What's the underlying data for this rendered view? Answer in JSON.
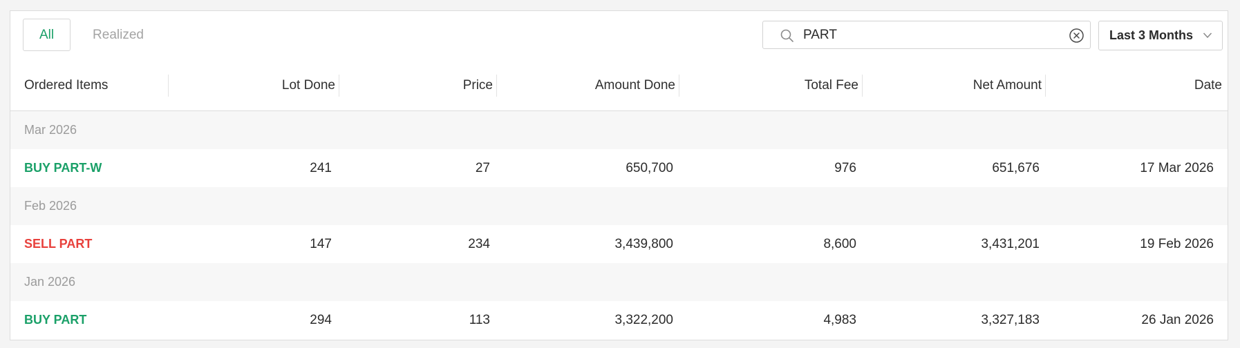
{
  "tabs": {
    "all": "All",
    "realized": "Realized"
  },
  "search": {
    "value": "PART",
    "placeholder": ""
  },
  "period": {
    "label": "Last 3 Months"
  },
  "columns": {
    "item": "Ordered Items",
    "lot": "Lot Done",
    "price": "Price",
    "amount": "Amount Done",
    "fee": "Total Fee",
    "net": "Net Amount",
    "date": "Date"
  },
  "groups": [
    {
      "label": "Mar 2026",
      "row": {
        "item": "BUY PART-W",
        "side": "buy",
        "lot": "241",
        "price": "27",
        "amount": "650,700",
        "fee": "976",
        "net": "651,676",
        "date": "17 Mar 2026"
      }
    },
    {
      "label": "Feb 2026",
      "row": {
        "item": "SELL PART",
        "side": "sell",
        "lot": "147",
        "price": "234",
        "amount": "3,439,800",
        "fee": "8,600",
        "net": "3,431,201",
        "date": "19 Feb 2026"
      }
    },
    {
      "label": "Jan 2026",
      "row": {
        "item": "BUY PART",
        "side": "buy",
        "lot": "294",
        "price": "113",
        "amount": "3,322,200",
        "fee": "4,983",
        "net": "3,327,183",
        "date": "26 Jan 2026"
      }
    }
  ],
  "colors": {
    "buy": "#1aa068",
    "sell": "#e8413c",
    "accent": "#1aa068"
  },
  "icons": {
    "search": "search-icon",
    "clear": "clear-circle-icon",
    "dropdown": "chevron-down-icon"
  }
}
